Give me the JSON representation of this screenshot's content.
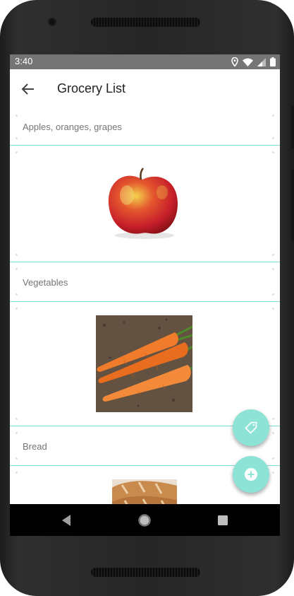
{
  "status_bar": {
    "time": "3:40",
    "icons": [
      "location-icon",
      "wifi-icon",
      "signal-icon",
      "battery-icon"
    ]
  },
  "app_bar": {
    "back_icon": "arrow-back-icon",
    "title": "Grocery List"
  },
  "list": {
    "items": [
      {
        "type": "text",
        "label": "Apples, oranges, grapes"
      },
      {
        "type": "image",
        "image": "apple-photo"
      },
      {
        "type": "text",
        "label": "Vegetables"
      },
      {
        "type": "image",
        "image": "carrots-photo"
      },
      {
        "type": "text",
        "label": "Bread"
      },
      {
        "type": "image",
        "image": "bread-photo"
      }
    ]
  },
  "fabs": [
    {
      "icon": "tag-icon"
    },
    {
      "icon": "add-icon"
    }
  ],
  "navigation": {
    "buttons": [
      "back-triangle-icon",
      "home-circle-icon",
      "recents-square-icon"
    ]
  },
  "colors": {
    "accent": "#8ee3d7",
    "divider": "#7fded3",
    "status_bar": "#757575",
    "nav_bar": "#000000"
  }
}
